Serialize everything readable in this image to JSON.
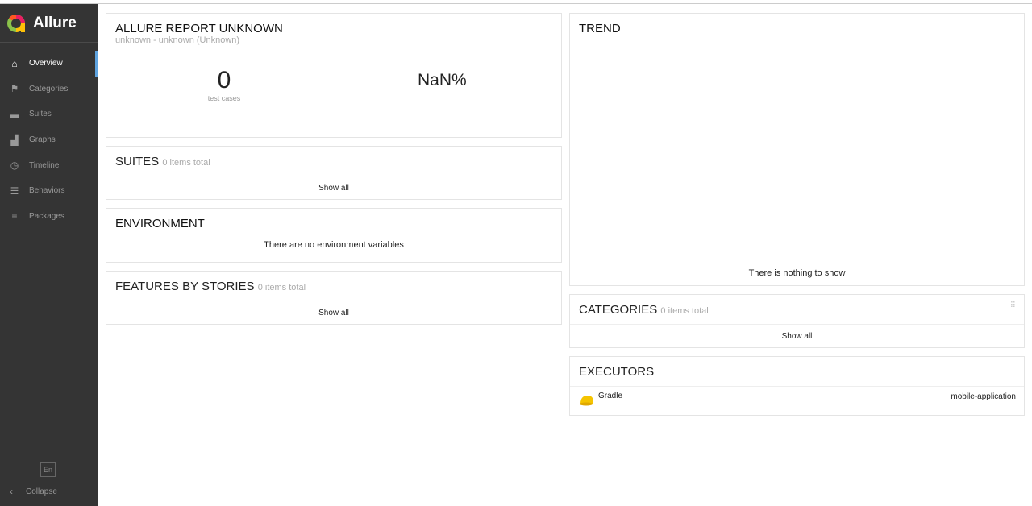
{
  "brand": {
    "name": "Allure"
  },
  "sidebar": {
    "items": [
      {
        "label": "Overview",
        "icon": "home-icon"
      },
      {
        "label": "Categories",
        "icon": "flag-icon"
      },
      {
        "label": "Suites",
        "icon": "briefcase-icon"
      },
      {
        "label": "Graphs",
        "icon": "bar-chart-icon"
      },
      {
        "label": "Timeline",
        "icon": "clock-icon"
      },
      {
        "label": "Behaviors",
        "icon": "list-icon"
      },
      {
        "label": "Packages",
        "icon": "align-left-icon"
      }
    ],
    "lang": "En",
    "collapse": "Collapse"
  },
  "summary": {
    "title": "ALLURE REPORT UNKNOWN",
    "subtitle": "unknown - unknown (Unknown)",
    "count": "0",
    "count_label": "test cases",
    "percent": "NaN%"
  },
  "suites": {
    "title": "SUITES",
    "total": "0 items total",
    "show_all": "Show all"
  },
  "environment": {
    "title": "ENVIRONMENT",
    "empty": "There are no environment variables"
  },
  "features": {
    "title": "FEATURES BY STORIES",
    "total": "0 items total",
    "show_all": "Show all"
  },
  "trend": {
    "title": "TREND",
    "empty": "There is nothing to show"
  },
  "categories": {
    "title": "CATEGORIES",
    "total": "0 items total",
    "show_all": "Show all"
  },
  "executors": {
    "title": "EXECUTORS",
    "name": "Gradle",
    "build": "mobile-application"
  }
}
